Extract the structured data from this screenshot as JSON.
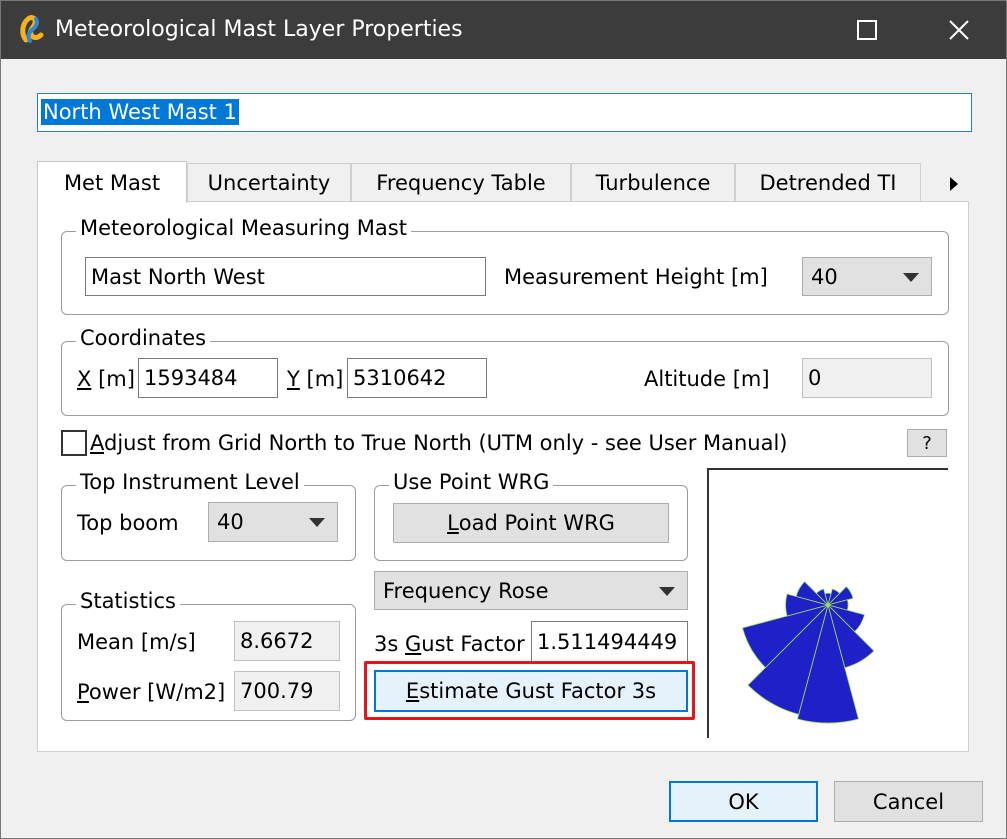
{
  "window": {
    "title": "Meteorological Mast Layer Properties",
    "layer_name": "North West Mast 1"
  },
  "tabs": [
    "Met Mast",
    "Uncertainty",
    "Frequency Table",
    "Turbulence",
    "Detrended TI"
  ],
  "mast": {
    "group_label": "Meteorological Measuring Mast",
    "name": "Mast North West",
    "height_label": "Measurement Height [m]",
    "height_value": "40"
  },
  "coordinates": {
    "group_label": "Coordinates",
    "x_label_accel": "X",
    "x_label_rest": " [m]",
    "x_value": "1593484",
    "y_label_accel": "Y",
    "y_label_rest": " [m]",
    "y_value": "5310642",
    "altitude_label": "Altitude [m]",
    "altitude_value": "0"
  },
  "adjust": {
    "label_accel": "A",
    "label_rest": "djust from Grid North to True North (UTM only - see User Manual)",
    "help_label": "?"
  },
  "top_instrument": {
    "group_label": "Top Instrument Level",
    "label": "Top boom",
    "value": "40"
  },
  "point_wrg": {
    "group_label": "Use Point WRG",
    "button_accel": "L",
    "button_rest": "oad Point WRG"
  },
  "rose": {
    "selector_value": "Frequency Rose",
    "color": "#2020c8",
    "sectors": [
      0.1,
      0.14,
      0.22,
      0.17,
      0.32,
      0.55,
      1.0,
      0.96,
      0.75,
      0.36,
      0.28,
      0.14
    ]
  },
  "gust": {
    "label_pre": "3s ",
    "label_accel": "G",
    "label_rest": "ust Factor",
    "value": "1.511494449",
    "button_accel": "E",
    "button_rest": "stimate Gust Factor 3s"
  },
  "statistics": {
    "group_label": "Statistics",
    "mean_label": "Mean [m/s]",
    "mean_value": "8.6672",
    "power_label_accel": "P",
    "power_label_rest": "ower [W/m2]",
    "power_value": "700.79"
  },
  "buttons": {
    "ok": "OK",
    "cancel": "Cancel"
  }
}
